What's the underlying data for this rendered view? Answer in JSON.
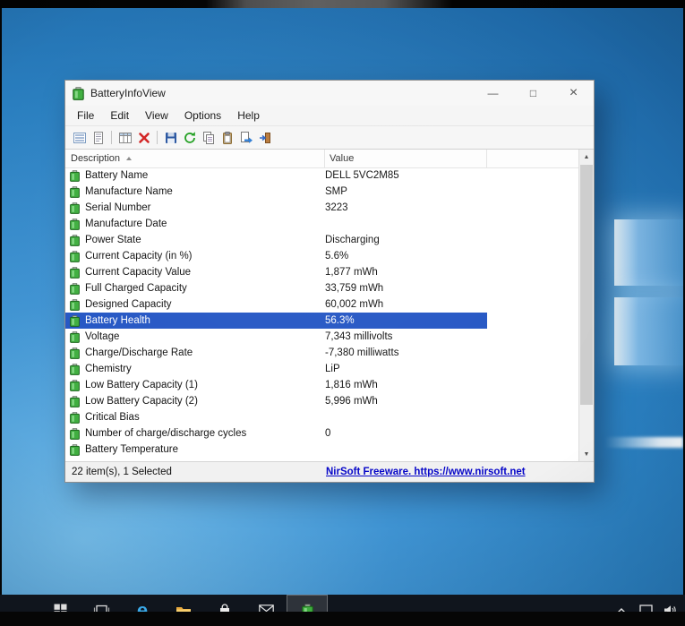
{
  "window": {
    "title": "BatteryInfoView",
    "controls": {
      "minimize": "—",
      "maximize": "□",
      "close": "×"
    },
    "menu_items": [
      "File",
      "Edit",
      "View",
      "Options",
      "Help"
    ],
    "toolbar_icons": [
      "battery-info-icon",
      "report-icon",
      "choose-columns-icon",
      "delete-icon",
      "save-icon",
      "refresh-icon",
      "copy-icon",
      "clipboard-icon",
      "export-icon",
      "exit-icon"
    ],
    "list": {
      "columns": [
        "Description",
        "Value"
      ],
      "rows": [
        {
          "description": "Battery Name",
          "value": "DELL 5VC2M85",
          "selected": false
        },
        {
          "description": "Manufacture Name",
          "value": "SMP",
          "selected": false
        },
        {
          "description": "Serial Number",
          "value": "3223",
          "selected": false
        },
        {
          "description": "Manufacture Date",
          "value": "",
          "selected": false
        },
        {
          "description": "Power State",
          "value": "Discharging",
          "selected": false
        },
        {
          "description": "Current Capacity (in %)",
          "value": "5.6%",
          "selected": false
        },
        {
          "description": "Current Capacity Value",
          "value": "1,877 mWh",
          "selected": false
        },
        {
          "description": "Full Charged Capacity",
          "value": "33,759 mWh",
          "selected": false
        },
        {
          "description": "Designed Capacity",
          "value": "60,002 mWh",
          "selected": false
        },
        {
          "description": "Battery Health",
          "value": "56.3%",
          "selected": true
        },
        {
          "description": "Voltage",
          "value": "7,343 millivolts",
          "selected": false
        },
        {
          "description": "Charge/Discharge Rate",
          "value": "-7,380 milliwatts",
          "selected": false
        },
        {
          "description": "Chemistry",
          "value": "LiP",
          "selected": false
        },
        {
          "description": "Low Battery Capacity (1)",
          "value": "1,816 mWh",
          "selected": false
        },
        {
          "description": "Low Battery Capacity (2)",
          "value": "5,996 mWh",
          "selected": false
        },
        {
          "description": "Critical Bias",
          "value": "",
          "selected": false
        },
        {
          "description": "Number of charge/discharge cycles",
          "value": "0",
          "selected": false
        },
        {
          "description": "Battery Temperature",
          "value": "",
          "selected": false
        }
      ]
    },
    "scrollbar": {
      "up": "▲",
      "down": "▼"
    },
    "status_bar": {
      "items_text": "22 item(s), 1 Selected",
      "link_text": "NirSoft Freeware. https://www.nirsoft.net"
    }
  },
  "taskbar": {
    "icons": [
      "start",
      "task-view",
      "edge",
      "file-explorer",
      "store",
      "mail",
      "batteryinfoview"
    ],
    "active_icon": "batteryinfoview",
    "edge_glyph": "e",
    "tray_icons": [
      "chevron-up",
      "display",
      "volume"
    ]
  },
  "colors": {
    "selection_blue": "#2456c4",
    "desktop_blue": "#2a7fc0",
    "link_blue": "#0404c8",
    "taskbar_dark": "#10151d",
    "battery_green": "#3fae3f"
  }
}
